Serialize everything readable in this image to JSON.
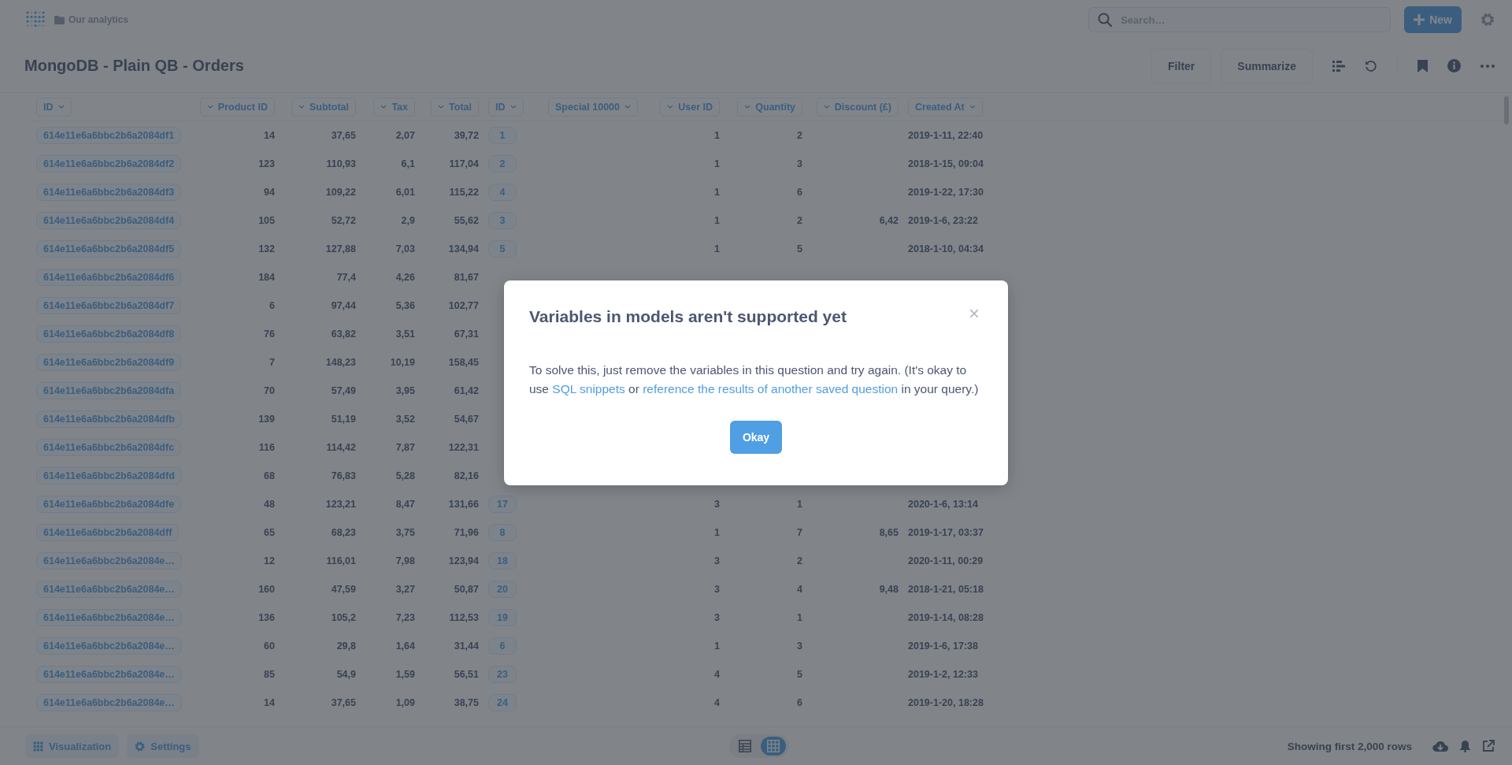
{
  "top_bar": {
    "breadcrumb": "Our analytics",
    "search": {
      "placeholder": "Search…"
    },
    "new_button": "New"
  },
  "question": {
    "title": "MongoDB - Plain QB - Orders",
    "actions": [
      "Filter",
      "Summarize"
    ]
  },
  "table": {
    "columns": [
      {
        "label": "ID",
        "kind": "pill"
      },
      {
        "label": "Product ID",
        "kind": "number"
      },
      {
        "label": "Subtotal",
        "kind": "number"
      },
      {
        "label": "Tax",
        "kind": "number"
      },
      {
        "label": "Total",
        "kind": "number"
      },
      {
        "label": "ID",
        "kind": "pill"
      },
      {
        "label": "Special 10000",
        "kind": "text"
      },
      {
        "label": "User ID",
        "kind": "number"
      },
      {
        "label": "Quantity",
        "kind": "number"
      },
      {
        "label": "Discount (£)",
        "kind": "number"
      },
      {
        "label": "Created At",
        "kind": "text"
      }
    ],
    "rows": [
      [
        "614e11e6a6bbc2b6a2084df1",
        "14",
        "37,65",
        "2,07",
        "39,72",
        "1",
        null,
        "1",
        "2",
        null,
        "2019-1-11, 22:40"
      ],
      [
        "614e11e6a6bbc2b6a2084df2",
        "123",
        "110,93",
        "6,1",
        "117,04",
        "2",
        null,
        "1",
        "3",
        null,
        "2018-1-15, 09:04"
      ],
      [
        "614e11e6a6bbc2b6a2084df3",
        "94",
        "109,22",
        "6,01",
        "115,22",
        "4",
        null,
        "1",
        "6",
        null,
        "2019-1-22, 17:30"
      ],
      [
        "614e11e6a6bbc2b6a2084df4",
        "105",
        "52,72",
        "2,9",
        "55,62",
        "3",
        null,
        "1",
        "2",
        "6,42",
        "2019-1-6, 23:22"
      ],
      [
        "614e11e6a6bbc2b6a2084df5",
        "132",
        "127,88",
        "7,03",
        "134,94",
        "5",
        null,
        "1",
        "5",
        null,
        "2018-1-10, 04:34"
      ],
      [
        "614e11e6a6bbc2b6a2084df6",
        "184",
        "77,4",
        "4,26",
        "81,67"
      ],
      [
        "614e11e6a6bbc2b6a2084df7",
        "6",
        "97,44",
        "5,36",
        "102,77"
      ],
      [
        "614e11e6a6bbc2b6a2084df8",
        "76",
        "63,82",
        "3,51",
        "67,31"
      ],
      [
        "614e11e6a6bbc2b6a2084df9",
        "7",
        "148,23",
        "10,19",
        "158,45"
      ],
      [
        "614e11e6a6bbc2b6a2084dfa",
        "70",
        "57,49",
        "3,95",
        "61,42"
      ],
      [
        "614e11e6a6bbc2b6a2084dfb",
        "139",
        "51,19",
        "3,52",
        "54,67"
      ],
      [
        "614e11e6a6bbc2b6a2084dfc",
        "116",
        "114,42",
        "7,87",
        "122,31"
      ],
      [
        "614e11e6a6bbc2b6a2084dfd",
        "68",
        "76,83",
        "5,28",
        "82,16"
      ],
      [
        "614e11e6a6bbc2b6a2084dfe",
        "48",
        "123,21",
        "8,47",
        "131,66",
        "17",
        null,
        "3",
        "1",
        null,
        "2020-1-6, 13:14"
      ],
      [
        "614e11e6a6bbc2b6a2084dff",
        "65",
        "68,23",
        "3,75",
        "71,96",
        "8",
        null,
        "1",
        "7",
        "8,65",
        "2019-1-17, 03:37"
      ],
      [
        "614e11e6a6bbc2b6a2084e…",
        "12",
        "116,01",
        "7,98",
        "123,94",
        "18",
        null,
        "3",
        "2",
        null,
        "2020-1-11, 00:29"
      ],
      [
        "614e11e6a6bbc2b6a2084e…",
        "160",
        "47,59",
        "3,27",
        "50,87",
        "20",
        null,
        "3",
        "4",
        "9,48",
        "2018-1-21, 05:18"
      ],
      [
        "614e11e6a6bbc2b6a2084e…",
        "136",
        "105,2",
        "7,23",
        "112,53",
        "19",
        null,
        "3",
        "1",
        null,
        "2019-1-14, 08:28"
      ],
      [
        "614e11e6a6bbc2b6a2084e…",
        "60",
        "29,8",
        "1,64",
        "31,44",
        "6",
        null,
        "1",
        "3",
        null,
        "2019-1-6, 17:38"
      ],
      [
        "614e11e6a6bbc2b6a2084e…",
        "85",
        "54,9",
        "1,59",
        "56,51",
        "23",
        null,
        "4",
        "5",
        null,
        "2019-1-2, 12:33"
      ],
      [
        "614e11e6a6bbc2b6a2084e…",
        "14",
        "37,65",
        "1,09",
        "38,75",
        "24",
        null,
        "4",
        "6",
        null,
        "2019-1-20, 18:28"
      ]
    ]
  },
  "footer": {
    "buttons": [
      "Visualization",
      "Settings"
    ],
    "view_toggle": [
      {
        "kind": "table",
        "selected": false
      },
      {
        "kind": "grid",
        "selected": true
      }
    ],
    "row_count": "Showing first 2,000 rows"
  },
  "modal": {
    "title": "Variables in models aren't supported yet",
    "close": "×",
    "body": [
      {
        "kind": "text",
        "text": "To solve this, just remove the variables in this question and try again. (It's okay to use "
      },
      {
        "kind": "link",
        "text": "SQL snippets"
      },
      {
        "kind": "text",
        "text": " or "
      },
      {
        "kind": "link",
        "text": "reference the results of another saved question"
      },
      {
        "kind": "text",
        "text": " in your query.)"
      }
    ],
    "button": "Okay"
  }
}
